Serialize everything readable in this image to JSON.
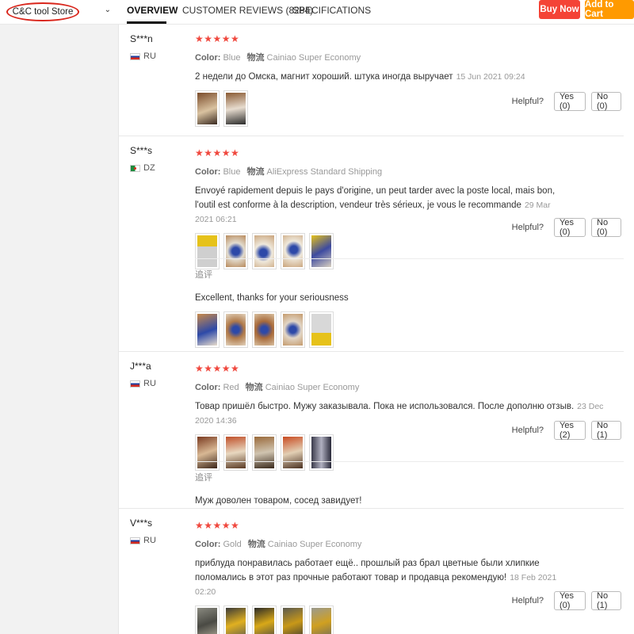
{
  "store": {
    "name": "C&C tool Store"
  },
  "nav": {
    "tabs": [
      "OVERVIEW",
      "CUSTOMER REVIEWS (8284)",
      "SPECIFICATIONS"
    ],
    "buy_now": "Buy Now",
    "add_to_cart": "Add to Cart"
  },
  "labels": {
    "color": "Color:",
    "shipping": "物流",
    "helpful": "Helpful?",
    "followup": "追评",
    "stars": "★★★★★"
  },
  "colors": {
    "buy_now": "#f44336",
    "add_to_cart": "#ff9a00",
    "stars": "#f0483e"
  },
  "reviews": [
    {
      "user": "S***n",
      "country": "RU",
      "rating": 5,
      "color": "Blue",
      "shipping": "Cainiao Super Economy",
      "text": "2 недели до Омска, магнит хороший. штука иногда выручает",
      "date": "15 Jun 2021 09:24",
      "photos": 2,
      "yes": "Yes (0)",
      "no": "No (0)"
    },
    {
      "user": "S***s",
      "country": "DZ",
      "rating": 5,
      "color": "Blue",
      "shipping": "AliExpress Standard Shipping",
      "text": "Envoyé rapidement depuis le pays d'origine, un peut tarder avec la poste local, mais bon, l'outil est conforme à la description, vendeur très sérieux, je vous le recommande",
      "date": "29 Mar 2021 06:21",
      "photos": 5,
      "yes": "Yes (0)",
      "no": "No (0)",
      "followup": "Excellent, thanks for your seriousness",
      "followup_photos": 5
    },
    {
      "user": "J***a",
      "country": "RU",
      "rating": 5,
      "color": "Red",
      "shipping": "Cainiao Super Economy",
      "text": "Товар пришёл быстро. Мужу заказывала. Пока не использовался. После дополню отзыв.",
      "date": "23 Dec 2020 14:36",
      "photos": 5,
      "yes": "Yes (2)",
      "no": "No (1)",
      "followup": "Муж доволен товаром, сосед завидует!"
    },
    {
      "user": "V***s",
      "country": "RU",
      "rating": 5,
      "color": "Gold",
      "shipping": "Cainiao Super Economy",
      "text": "приблуда понравилась работает ещё.. прошлый раз брал цветные были хлипкие поломались в этот раз прочные работают товар и продавца рекомендую!",
      "date": "18 Feb 2021 02:20",
      "photos": 5,
      "yes": "Yes (0)",
      "no": "No (1)"
    }
  ]
}
